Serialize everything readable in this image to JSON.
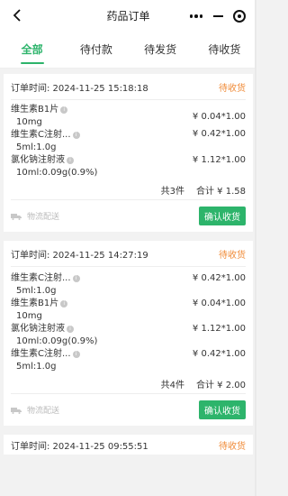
{
  "app": {
    "title": "药品订单"
  },
  "tabs": [
    {
      "label": "全部",
      "active": true
    },
    {
      "label": "待付款",
      "active": false
    },
    {
      "label": "待发货",
      "active": false
    },
    {
      "label": "待收货",
      "active": false
    }
  ],
  "icons": {
    "back": "back-arrow-icon",
    "more": "more-dots-icon",
    "minimize": "minimize-icon",
    "close": "target-close-icon",
    "info": "info-icon",
    "delivery": "truck-icon"
  },
  "colors": {
    "accent": "#2db46b",
    "status": "#f08c3a"
  },
  "orders": [
    {
      "time": "订单时间: 2024-11-25 15:18:18",
      "status": "待收货",
      "items": [
        {
          "name": "维生素B1片",
          "spec": "10mg",
          "price": "¥ 0.04*1.00"
        },
        {
          "name": "维生素C注射...",
          "spec": "5ml:1.0g",
          "price": "¥ 0.42*1.00"
        },
        {
          "name": "氯化钠注射液",
          "spec": "10ml:0.09g(0.9%)",
          "price": "¥ 1.12*1.00"
        }
      ],
      "count": "共3件",
      "total": "合计 ¥ 1.58",
      "delivery": "物流配送",
      "button": "确认收货"
    },
    {
      "time": "订单时间: 2024-11-25 14:27:19",
      "status": "待收货",
      "items": [
        {
          "name": "维生素C注射...",
          "spec": "5ml:1.0g",
          "price": "¥ 0.42*1.00"
        },
        {
          "name": "维生素B1片",
          "spec": "10mg",
          "price": "¥ 0.04*1.00"
        },
        {
          "name": "氯化钠注射液",
          "spec": "10ml:0.09g(0.9%)",
          "price": "¥ 1.12*1.00"
        },
        {
          "name": "维生素C注射...",
          "spec": "5ml:1.0g",
          "price": "¥ 0.42*1.00"
        }
      ],
      "count": "共4件",
      "total": "合计 ¥ 2.00",
      "delivery": "物流配送",
      "button": "确认收货"
    }
  ],
  "partial_order": {
    "time": "订单时间: 2024-11-25 09:55:51",
    "status": "待收货"
  }
}
